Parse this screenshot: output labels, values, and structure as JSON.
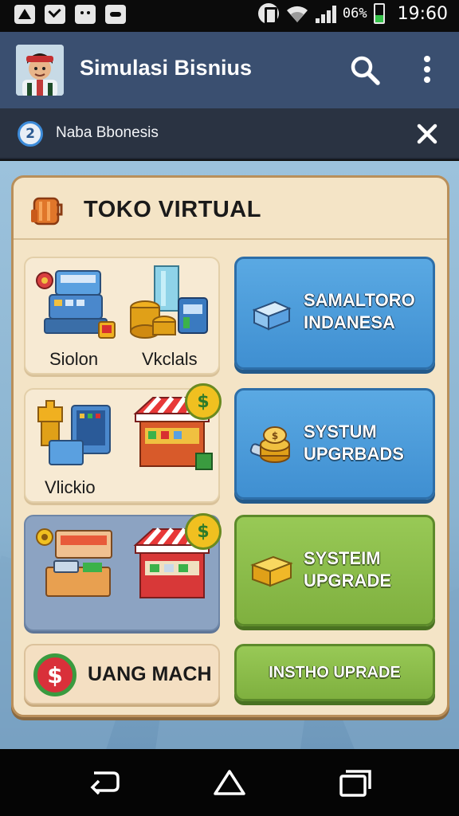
{
  "status_bar": {
    "battery_pct": "06%",
    "time": "19:60",
    "icons": [
      "alert-icon",
      "checkbox-icon",
      "face-icon",
      "photo-icon",
      "vibrate-icon",
      "wifi-icon",
      "signal-icon",
      "battery-icon"
    ]
  },
  "app_bar": {
    "title": "Simulasi Bisnius",
    "icons": [
      "avatar",
      "search-icon",
      "more-vert-icon"
    ]
  },
  "notice": {
    "text": "Naba Bbonesis",
    "icon_label": "2"
  },
  "panel": {
    "title": "TOKO VIRTUAL",
    "tiles": [
      {
        "labels": [
          "Siolon",
          "Vkclals"
        ]
      },
      {
        "labels": [
          "Vlickio"
        ]
      },
      {
        "labels": []
      }
    ],
    "buttons": [
      {
        "text_line1": "SAMALTORO",
        "text_line2": "INDANESA",
        "color": "#4a9ddc"
      },
      {
        "text_line1": "SYSTUM",
        "text_line2": "UPGRBADS",
        "color": "#4a9ddc"
      },
      {
        "text_line1": "SYSTEIM",
        "text_line2": "UPGRADE",
        "color": "#8cbf4b"
      },
      {
        "text": "INSTHO UPRADE",
        "color": "#8cbf4b"
      }
    ],
    "money": {
      "label": "UANG MACH",
      "symbol": "$"
    }
  },
  "nav_bar": {
    "icons": [
      "back-icon",
      "home-icon",
      "recents-icon"
    ]
  },
  "colors": {
    "app_bar": "#3a4f70",
    "notice_bar": "#2a3342",
    "panel_bg": "#f4e4c6",
    "blue_button": "#4a9ddc",
    "green_button": "#8cbf4b"
  }
}
